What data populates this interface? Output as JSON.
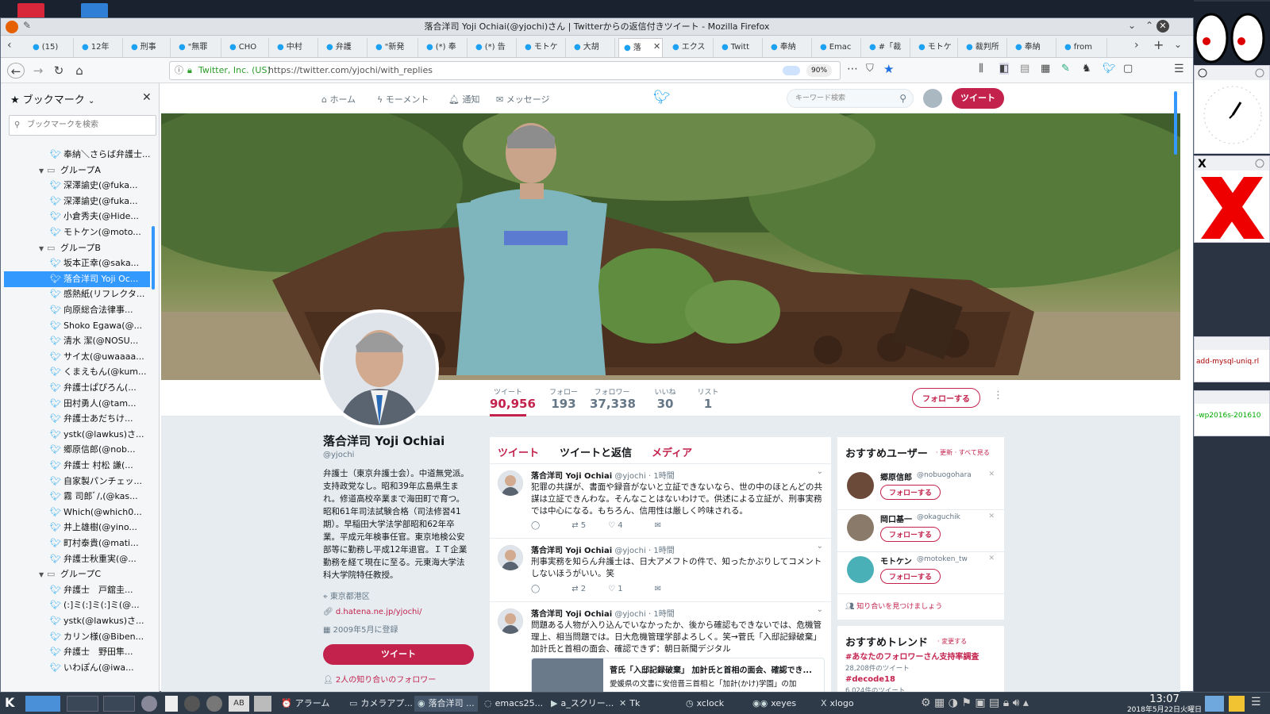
{
  "window": {
    "title": "落合洋司 Yoji Ochiai(@yjochi)さん | Twitterからの返信付きツイート - Mozilla Firefox"
  },
  "tabs": [
    {
      "label": "(15)"
    },
    {
      "label": "12年"
    },
    {
      "label": "刑事"
    },
    {
      "label": "\"無罪"
    },
    {
      "label": "CHO"
    },
    {
      "label": "中村"
    },
    {
      "label": "弁護"
    },
    {
      "label": "\"新発"
    },
    {
      "label": "(*) 奉"
    },
    {
      "label": "(*) 告"
    },
    {
      "label": "モトケ"
    },
    {
      "label": "大胡"
    },
    {
      "label": "落"
    },
    {
      "label": "エクス"
    },
    {
      "label": "Twitt"
    },
    {
      "label": "奉納"
    },
    {
      "label": "Emac"
    },
    {
      "label": "#「裁"
    },
    {
      "label": "モトケ"
    },
    {
      "label": "裁判所"
    },
    {
      "label": "奉納"
    },
    {
      "label": "from"
    }
  ],
  "navbar": {
    "identity": "Twitter, Inc. (US)",
    "url": "https://twitter.com/yjochi/with_replies",
    "zoom": "90%"
  },
  "bookmarks": {
    "header": "ブックマーク",
    "search_placeholder": "ブックマークを検索",
    "items": [
      {
        "label": "奉納＼さらば弁護士...",
        "type": "bm",
        "indent": 2
      },
      {
        "label": "グループA",
        "type": "folder",
        "indent": 1
      },
      {
        "label": "深澤諭史(@fuka...",
        "type": "bm",
        "indent": 2
      },
      {
        "label": "深澤諭史(@fuka...",
        "type": "bm",
        "indent": 2
      },
      {
        "label": "小倉秀夫(@Hide...",
        "type": "bm",
        "indent": 2
      },
      {
        "label": "モトケン(@moto...",
        "type": "bm",
        "indent": 2
      },
      {
        "label": "グループB",
        "type": "folder",
        "indent": 1
      },
      {
        "label": "坂本正幸(@saka...",
        "type": "bm",
        "indent": 2
      },
      {
        "label": "落合洋司 Yoji Oc...",
        "type": "bm",
        "indent": 2,
        "selected": true
      },
      {
        "label": "感熱紙(リフレクタ...",
        "type": "bm",
        "indent": 2
      },
      {
        "label": "向原総合法律事...",
        "type": "bm",
        "indent": 2
      },
      {
        "label": "Shoko Egawa(@...",
        "type": "bm",
        "indent": 2
      },
      {
        "label": "清水 潔(@NOSU...",
        "type": "bm",
        "indent": 2
      },
      {
        "label": "サイ太(@uwaaaa...",
        "type": "bm",
        "indent": 2
      },
      {
        "label": "くまえもん(@kum...",
        "type": "bm",
        "indent": 2
      },
      {
        "label": "弁護士ぱぴろん(...",
        "type": "bm",
        "indent": 2
      },
      {
        "label": "田村勇人(@tam...",
        "type": "bm",
        "indent": 2
      },
      {
        "label": "弁護士あだちけ...",
        "type": "bm",
        "indent": 2
      },
      {
        "label": "ystk(@lawkus)さ...",
        "type": "bm",
        "indent": 2
      },
      {
        "label": "郷原信郎(@nob...",
        "type": "bm",
        "indent": 2
      },
      {
        "label": "弁護士 村松 謙(...",
        "type": "bm",
        "indent": 2
      },
      {
        "label": "自家製パンチェッ...",
        "type": "bm",
        "indent": 2
      },
      {
        "label": "霧 司郎ﾞ/,(@kas...",
        "type": "bm",
        "indent": 2
      },
      {
        "label": "Which(@which0...",
        "type": "bm",
        "indent": 2
      },
      {
        "label": "井上雄樹(@yino...",
        "type": "bm",
        "indent": 2
      },
      {
        "label": "町村泰貴(@mati...",
        "type": "bm",
        "indent": 2
      },
      {
        "label": "弁護士秋重実(@...",
        "type": "bm",
        "indent": 2
      },
      {
        "label": "グループC",
        "type": "folder",
        "indent": 1
      },
      {
        "label": "弁護士　戸舘圭...",
        "type": "bm",
        "indent": 2
      },
      {
        "label": "(:]ミ(:]ミ(:]ミ(@...",
        "type": "bm",
        "indent": 2
      },
      {
        "label": "ystk(@lawkus)さ...",
        "type": "bm",
        "indent": 2
      },
      {
        "label": "カリン様(@Biben...",
        "type": "bm",
        "indent": 2
      },
      {
        "label": "弁護士　野田隼...",
        "type": "bm",
        "indent": 2
      },
      {
        "label": "いわぽん(@iwa...",
        "type": "bm",
        "indent": 2
      }
    ]
  },
  "twitter_nav": {
    "home": "ホーム",
    "moments": "モーメント",
    "notifications": "通知",
    "messages": "メッセージ",
    "search_placeholder": "キーワード検索",
    "tweet_button": "ツイート"
  },
  "profile_stats": [
    {
      "label": "ツイート",
      "value": "90,956",
      "active": true
    },
    {
      "label": "フォロー",
      "value": "193"
    },
    {
      "label": "フォロワー",
      "value": "37,338"
    },
    {
      "label": "いいね",
      "value": "30"
    },
    {
      "label": "リスト",
      "value": "1"
    }
  ],
  "follow_button": "フォローする",
  "profile": {
    "name": "落合洋司 Yoji Ochiai",
    "handle": "@yjochi",
    "bio": "弁護士（東京弁護士会）。中道無党派。支持政党なし。昭和39年広島県生まれ。修道高校卒業まで海田町で育つ。昭和61年司法試験合格（司法修習41期）。早稲田大学法学部昭和62年卒業。平成元年検事任官。東京地検公安部等に勤務し平成12年退官。ＩＴ企業勤務を経て現在に至る。元東海大学法科大学院特任教授。",
    "location": "東京都港区",
    "link": "d.hatena.ne.jp/yjochi/",
    "joined": "2009年5月に登録",
    "tweet_button": "ツイート",
    "followers_you_know": "2人の知り合いのフォロワー"
  },
  "timeline_tabs": [
    "ツイート",
    "ツイートと返信",
    "メディア"
  ],
  "tweets": [
    {
      "name": "落合洋司 Yoji Ochiai",
      "handle": "@yjochi",
      "time": "· 1時間",
      "text": "犯罪の共謀が、書面や録音がないと立証できないなら、世の中のほとんどの共謀は立証できんわな。そんなことはないわけで。供述による立証が、刑事実務では中心になる。もちろん、信用性は厳しく吟味される。",
      "retweets": "5",
      "likes": "4"
    },
    {
      "name": "落合洋司 Yoji Ochiai",
      "handle": "@yjochi",
      "time": "· 1時間",
      "text": "刑事実務を知らん弁護士は、日大アメフトの件で、知ったかぶりしてコメントしないほうがいい。笑",
      "retweets": "2",
      "likes": "1"
    },
    {
      "name": "落合洋司 Yoji Ochiai",
      "handle": "@yjochi",
      "time": "· 1時間",
      "text": "問題ある人物が入り込んでいなかったか、後から確認もできないでは、危機管理上、相当問題では。日大危機管理学部よろしく。笑→菅氏「入邸記録破棄」 加計氏と首相の面会、確認できず：朝日新聞デジタル",
      "card_title": "菅氏「入邸記録破棄」 加計氏と首相の面会、確認でき...",
      "card_text": "愛媛県の文書に安倍晋三首相と「加計(かけ)学園」の加"
    }
  ],
  "suggest_users": {
    "title": "おすすめユーザー",
    "links": "· 更新 · すべて見る",
    "users": [
      {
        "name": "郷原信郎",
        "handle": "@nobuogohara"
      },
      {
        "name": "岡口基一",
        "handle": "@okaguchik"
      },
      {
        "name": "モトケン",
        "handle": "@motoken_tw"
      }
    ],
    "find_friends": "知り合いを見つけましょう"
  },
  "trends": {
    "title": "おすすめトレンド",
    "change": "· 変更する",
    "items": [
      {
        "tag": "#あなたのフォロワーさん支持率調査",
        "count": "28,208件のツイート"
      },
      {
        "tag": "#decode18",
        "count": "6,024件のツイート"
      }
    ]
  },
  "right_windows": {
    "snippet1": "add-mysql-uniq.rl",
    "snippet2": "-wp2016s-201610"
  },
  "taskbar": {
    "items": [
      "アラーム",
      "カメラアプ...",
      "落合洋司 ...",
      "emacs25...",
      "a_スクリー...",
      "Tk",
      "xclock",
      "xeyes",
      "xlogo"
    ],
    "time": "13:07",
    "date": "2018年5月22日火曜日"
  },
  "colors": {
    "accent": "#c3224d",
    "twitter_blue": "#1da1f2",
    "selection": "#3399ff"
  }
}
